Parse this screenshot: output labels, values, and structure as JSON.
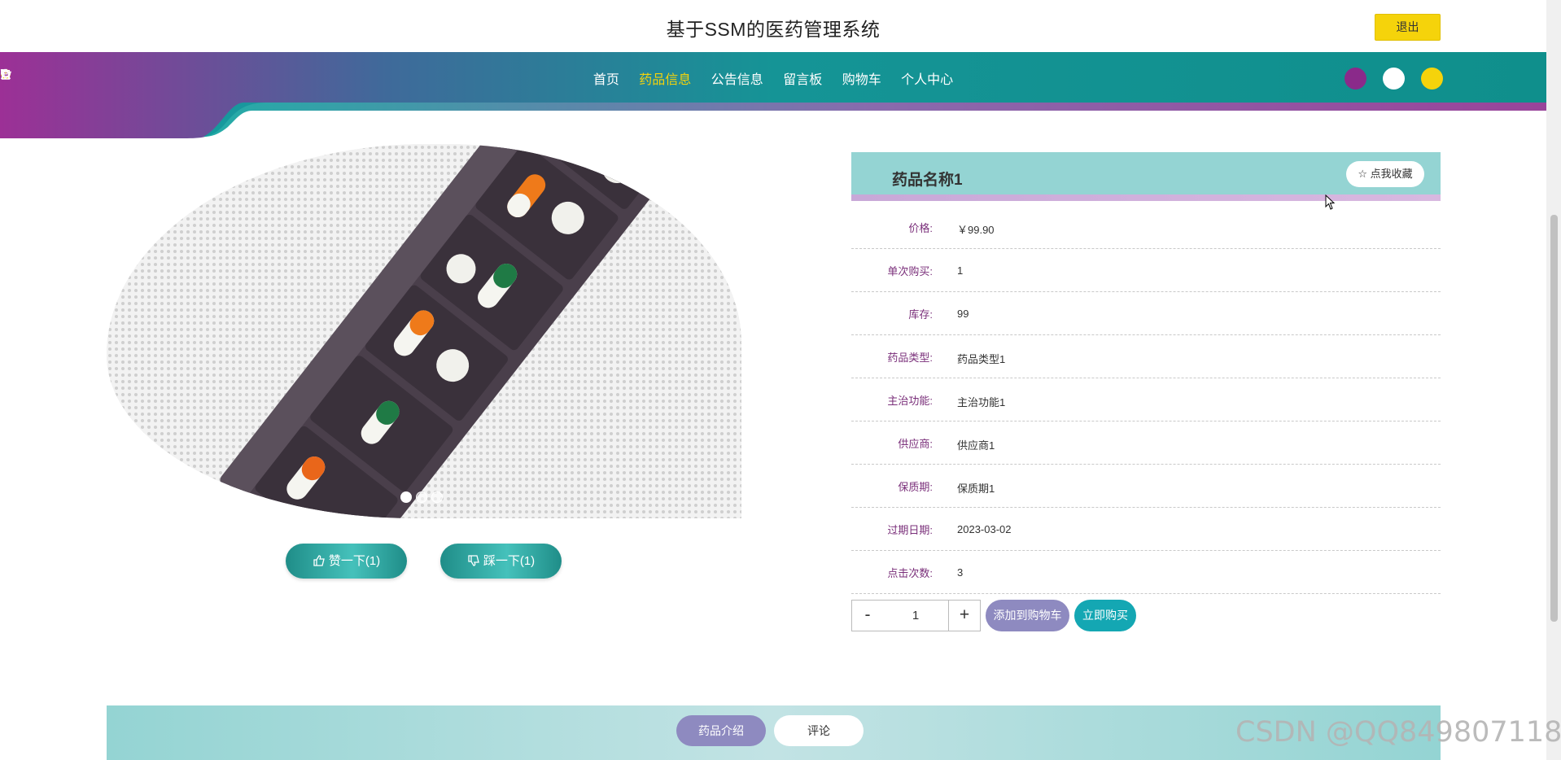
{
  "header": {
    "title": "基于SSM的医药管理系统",
    "logout_label": "退出"
  },
  "nav": {
    "items": [
      {
        "label": "首页",
        "icon": "home-icon"
      },
      {
        "label": "药品信息",
        "icon": "power-icon",
        "active": true
      },
      {
        "label": "公告信息",
        "icon": "tag-icon"
      },
      {
        "label": "留言板",
        "icon": "clipboard-icon"
      },
      {
        "label": "购物车",
        "icon": "cart-icon"
      },
      {
        "label": "个人中心",
        "icon": "user-icon"
      }
    ],
    "theme_colors": [
      "#8a2a8a",
      "#ffffff",
      "#f5d30b"
    ],
    "active_color": "#f5d30b"
  },
  "gallery": {
    "image_icon": "pill-organizer-image",
    "dots": 3,
    "active_dot": 1
  },
  "votes": {
    "like_label": "赞一下(1)",
    "dislike_label": "踩一下(1)"
  },
  "product": {
    "name": "药品名称1",
    "fav_label": "点我收藏",
    "fields": [
      {
        "label": "价格:",
        "value": "￥99.90"
      },
      {
        "label": "单次购买:",
        "value": "1"
      },
      {
        "label": "库存:",
        "value": "99"
      },
      {
        "label": "药品类型:",
        "value": "药品类型1"
      },
      {
        "label": "主治功能:",
        "value": "主治功能1"
      },
      {
        "label": "供应商:",
        "value": "供应商1"
      },
      {
        "label": "保质期:",
        "value": "保质期1"
      },
      {
        "label": "过期日期:",
        "value": "2023-03-02"
      },
      {
        "label": "点击次数:",
        "value": "3"
      }
    ]
  },
  "purchase": {
    "minus": "-",
    "quantity": "1",
    "plus": "+",
    "add_to_cart": "添加到购物车",
    "buy_now": "立即购买"
  },
  "tabs": {
    "intro": "药品介绍",
    "comment": "评论"
  },
  "watermark": "CSDN @QQ849807118"
}
